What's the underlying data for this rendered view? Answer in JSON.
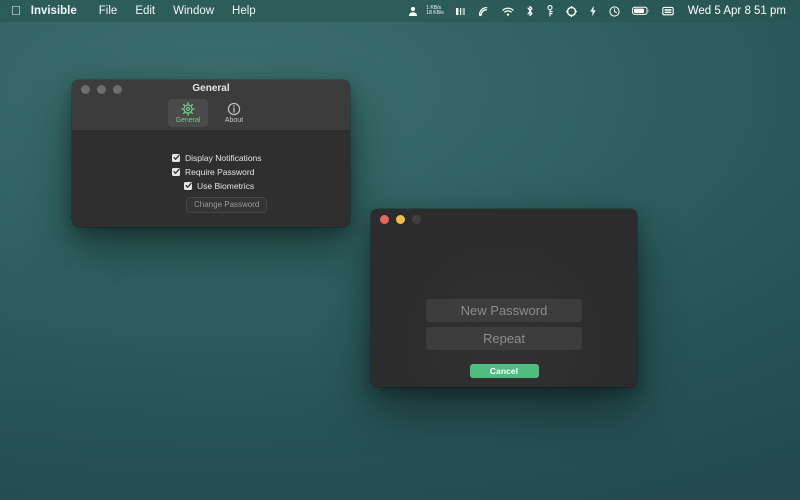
{
  "menubar": {
    "apple_icon": "apple-logo",
    "app_name": "Invisible",
    "menus": [
      "File",
      "Edit",
      "Window",
      "Help"
    ],
    "status": {
      "user_icon": "user-icon",
      "net_down": "1 KB/s",
      "net_up": "18 KB/s",
      "icons": [
        "volume-bars-icon",
        "cellular-signal-icon",
        "wifi-icon",
        "bluetooth-icon",
        "keychain-icon",
        "gear-icon",
        "power-bolt-icon",
        "time-machine-icon",
        "battery-icon",
        "display-icon"
      ],
      "clock": "Wed 5 Apr  8 51 pm"
    }
  },
  "settings_window": {
    "title": "General",
    "traffic_lights": [
      "close",
      "minimize",
      "zoom"
    ],
    "toolbar": [
      {
        "id": "general",
        "label": "General",
        "icon": "gear-icon",
        "selected": true
      },
      {
        "id": "about",
        "label": "About",
        "icon": "info-circle-icon",
        "selected": false
      }
    ],
    "options": [
      {
        "label": "Display Notifications",
        "checked": true,
        "indented": false
      },
      {
        "label": "Require Password",
        "checked": true,
        "indented": false
      },
      {
        "label": "Use Biometrics",
        "checked": true,
        "indented": true
      }
    ],
    "change_password_label": "Change Password"
  },
  "password_dialog": {
    "traffic_lights": [
      "close",
      "minimize",
      "zoom-disabled"
    ],
    "fields": [
      {
        "id": "new-password",
        "placeholder": "New Password",
        "value": ""
      },
      {
        "id": "repeat-password",
        "placeholder": "Repeat",
        "value": ""
      }
    ],
    "cancel_label": "Cancel"
  },
  "colors": {
    "desktop_teal": "#2a5a5d",
    "window_body": "#2e2e2e",
    "titlebar": "#3b3b3b",
    "accent_green": "#4fbd80",
    "tab_active_green": "#76c98a",
    "field_bg": "#3c3c3c",
    "close_red": "#e8695e",
    "minimize_yellow": "#f0bf4c"
  }
}
